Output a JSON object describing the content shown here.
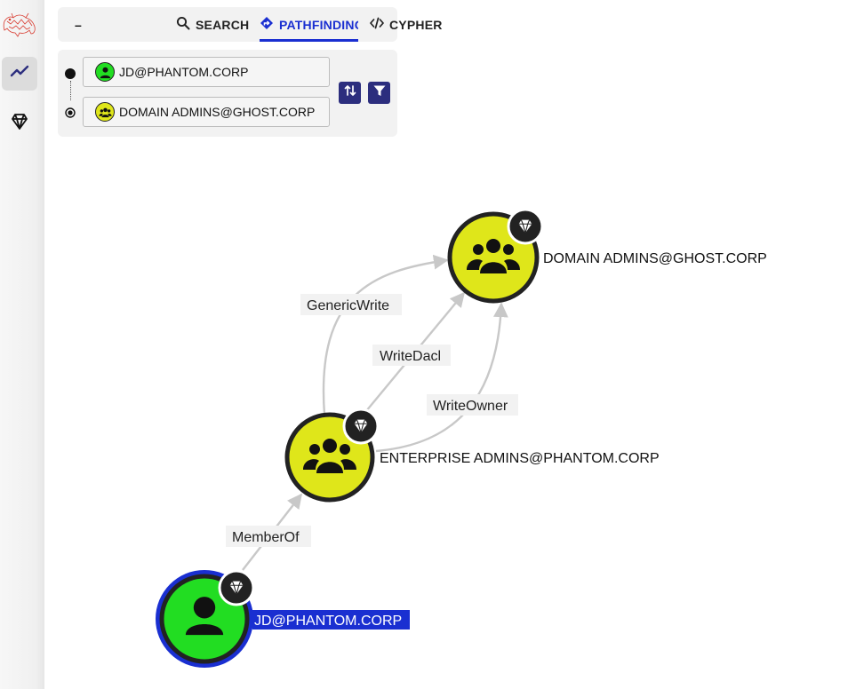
{
  "nav": {
    "logo": "bloodhound-logo",
    "items": [
      {
        "icon": "graph-line-icon",
        "active": true
      },
      {
        "icon": "gem-icon",
        "active": false
      }
    ]
  },
  "tabs": {
    "collapse_label": "–",
    "search_label": "SEARCH",
    "pathfinding_label": "PATHFINDING",
    "cypher_label": "CYPHER",
    "active": "pathfinding"
  },
  "pathfinding": {
    "start_value": "JD@PHANTOM.CORP",
    "start_icon": "user-icon",
    "end_value": "DOMAIN ADMINS@GHOST.CORP",
    "end_icon": "group-icon",
    "swap_icon": "swap-icon",
    "filter_icon": "filter-icon"
  },
  "colors": {
    "accent": "#1a2fd1",
    "button": "#2c2e7e",
    "user_node": "#22dd22",
    "group_node": "#dfe61a",
    "edge": "#c8c8c8",
    "selection": "#1a2fd1"
  },
  "graph": {
    "nodes": [
      {
        "id": "da",
        "label": "DOMAIN ADMINS@GHOST.CORP",
        "kind": "group",
        "badge": "gem-icon"
      },
      {
        "id": "ea",
        "label": "ENTERPRISE ADMINS@PHANTOM.CORP",
        "kind": "group",
        "badge": "gem-icon"
      },
      {
        "id": "jd",
        "label": "JD@PHANTOM.CORP",
        "kind": "user",
        "badge": "gem-icon",
        "selected": true
      }
    ],
    "edges": [
      {
        "from": "ea",
        "to": "da",
        "label": "GenericWrite"
      },
      {
        "from": "ea",
        "to": "da",
        "label": "WriteDacl"
      },
      {
        "from": "ea",
        "to": "da",
        "label": "WriteOwner"
      },
      {
        "from": "jd",
        "to": "ea",
        "label": "MemberOf"
      }
    ]
  }
}
